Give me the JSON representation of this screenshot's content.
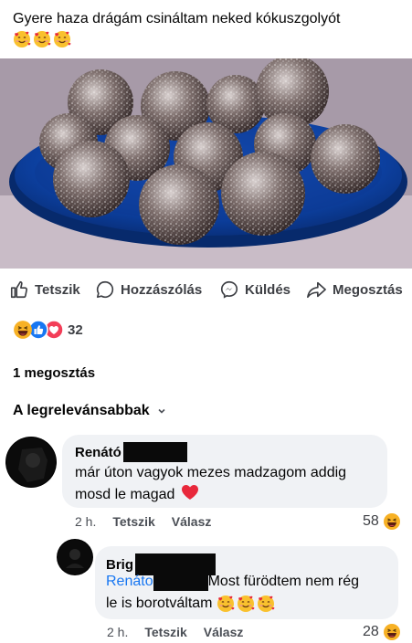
{
  "post": {
    "text": "Gyere haza drágám csináltam neked kókuszgolyót",
    "emojis": [
      "smiling-face-with-hearts-icon",
      "smiling-face-with-hearts-icon",
      "smiling-face-with-hearts-icon"
    ]
  },
  "photo": {
    "alt": "kókuszgolyó"
  },
  "actions": [
    {
      "label": "Tetszik",
      "icon": "thumbs-up-icon"
    },
    {
      "label": "Hozzászólás",
      "icon": "comment-icon"
    },
    {
      "label": "Küldés",
      "icon": "messenger-icon"
    },
    {
      "label": "Megosztás",
      "icon": "share-icon"
    }
  ],
  "reactions": {
    "count": "32",
    "icons": [
      "haha-icon",
      "like-icon",
      "love-icon"
    ]
  },
  "shares": "1 megosztás",
  "sort": {
    "label": "A legrelevánsabbak"
  },
  "comments": [
    {
      "author": "Renátó",
      "text": "már úton vagyok mezes madzagom addig mosd le magad",
      "time": "2 h.",
      "like": "Tetszik",
      "reply": "Válasz",
      "reaction_count": "58"
    },
    {
      "author": "Brig",
      "mention": "Renáto",
      "text_line1": "Most fürödtem nem rég",
      "text_line2": "le is borotváltam",
      "time": "2 h.",
      "like": "Tetszik",
      "reply": "Válasz",
      "reaction_count": "28"
    }
  ],
  "colors": {
    "accent": "#1877f2",
    "bubble": "#f0f2f5",
    "love": "#f33e58",
    "haha": "#f7b125"
  }
}
